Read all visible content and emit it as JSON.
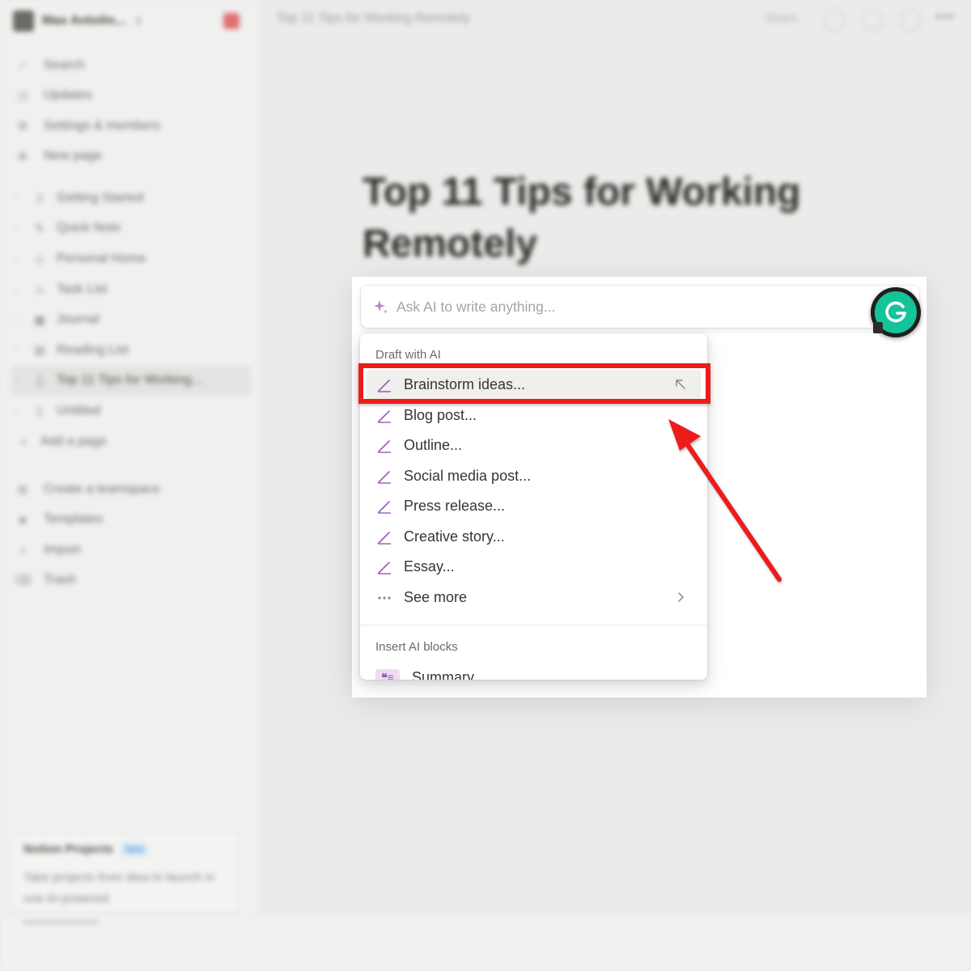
{
  "sidebar": {
    "workspace_name": "Max Antolin...",
    "nav": [
      {
        "label": "Search",
        "icon": "search-icon"
      },
      {
        "label": "Updates",
        "icon": "clock-icon"
      },
      {
        "label": "Settings & members",
        "icon": "gear-icon"
      },
      {
        "label": "New page",
        "icon": "plus-circle-icon"
      }
    ],
    "pages": [
      {
        "label": "Getting Started",
        "icon": "page-icon"
      },
      {
        "label": "Quick Note",
        "icon": "pin-icon"
      },
      {
        "label": "Personal Home",
        "icon": "person-icon"
      },
      {
        "label": "Task List",
        "icon": "person-icon"
      },
      {
        "label": "Journal",
        "icon": "grid-icon"
      },
      {
        "label": "Reading List",
        "icon": "book-icon"
      },
      {
        "label": "Top 11 Tips for Working...",
        "icon": "page-icon"
      },
      {
        "label": "Untitled",
        "icon": "page-icon"
      },
      {
        "label": "Add a page",
        "icon": "plus-icon"
      }
    ],
    "bottom": [
      {
        "label": "Create a teamspace",
        "icon": "teamspace-icon"
      },
      {
        "label": "Templates",
        "icon": "templates-icon"
      },
      {
        "label": "Import",
        "icon": "import-icon"
      },
      {
        "label": "Trash",
        "icon": "trash-icon"
      }
    ],
    "projects_card": {
      "title": "Notion Projects",
      "badge": "New",
      "description": "Take projects from idea to launch in one AI-powered"
    }
  },
  "topbar": {
    "breadcrumb": "Top 11 Tips for Working Remotely",
    "share": "Share"
  },
  "page": {
    "title": "Top 11 Tips for Working Remotely"
  },
  "ai": {
    "placeholder": "Ask AI to write anything...",
    "menu": {
      "section_draft": "Draft with AI",
      "items": [
        {
          "label": "Brainstorm ideas...",
          "icon": "pencil-icon",
          "highlighted": true
        },
        {
          "label": "Blog post...",
          "icon": "pencil-icon"
        },
        {
          "label": "Outline...",
          "icon": "pencil-icon"
        },
        {
          "label": "Social media post...",
          "icon": "pencil-icon"
        },
        {
          "label": "Press release...",
          "icon": "pencil-icon"
        },
        {
          "label": "Creative story...",
          "icon": "pencil-icon"
        },
        {
          "label": "Essay...",
          "icon": "pencil-icon"
        },
        {
          "label": "See more",
          "icon": "ellipsis-icon",
          "submenu": true
        }
      ],
      "section_blocks": "Insert AI blocks",
      "blocks": [
        {
          "label": "Summary",
          "icon": "quote-icon"
        }
      ]
    }
  },
  "colors": {
    "accent_purple": "#9b59b6",
    "annotation_red": "#ec1c1c",
    "grammarly_green": "#15c39a"
  }
}
